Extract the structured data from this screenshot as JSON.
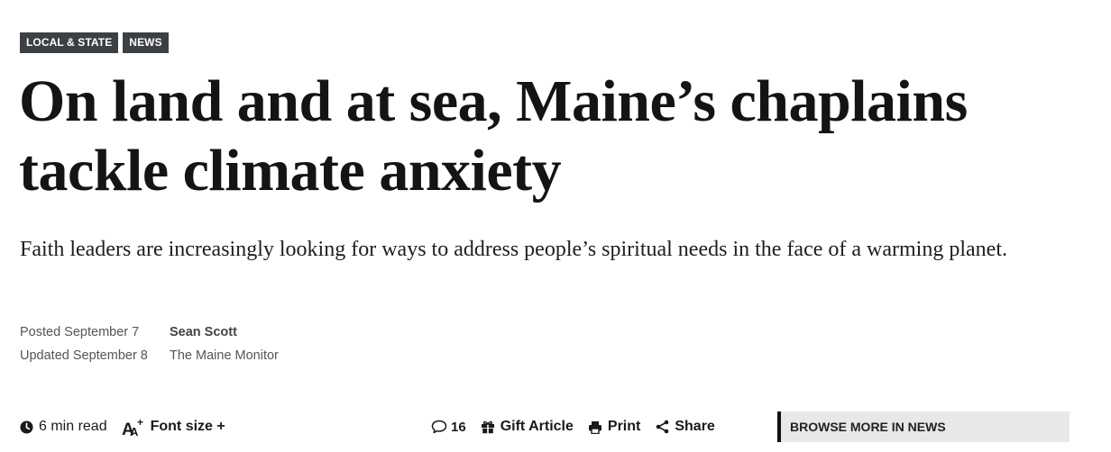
{
  "tags": [
    "LOCAL & STATE",
    "NEWS"
  ],
  "headline": "On land and at sea, Maine’s chaplains tackle climate anxiety",
  "dek": "Faith leaders are increasingly looking for ways to address people’s spiritual needs in the face of a warming planet.",
  "meta": {
    "posted": "Posted September 7",
    "updated": "Updated September 8",
    "author": "Sean Scott",
    "organization": "The Maine Monitor"
  },
  "toolbar": {
    "read_time": "6 min read",
    "font_size": "Font size +",
    "comment_count": "16",
    "gift_article": "Gift Article",
    "print": "Print",
    "share": "Share"
  },
  "browse_more": "BROWSE MORE IN NEWS",
  "icons": {
    "read_time": "clock-icon",
    "font_size": "font-size-icon",
    "comments": "comment-bubble-icon",
    "gift": "gift-icon",
    "print": "printer-icon",
    "share": "share-icon"
  },
  "colors": {
    "tag_bg": "#3d4043",
    "browse_bg": "#e8e8e8",
    "text": "#1a1a1a",
    "meta": "#555555"
  }
}
